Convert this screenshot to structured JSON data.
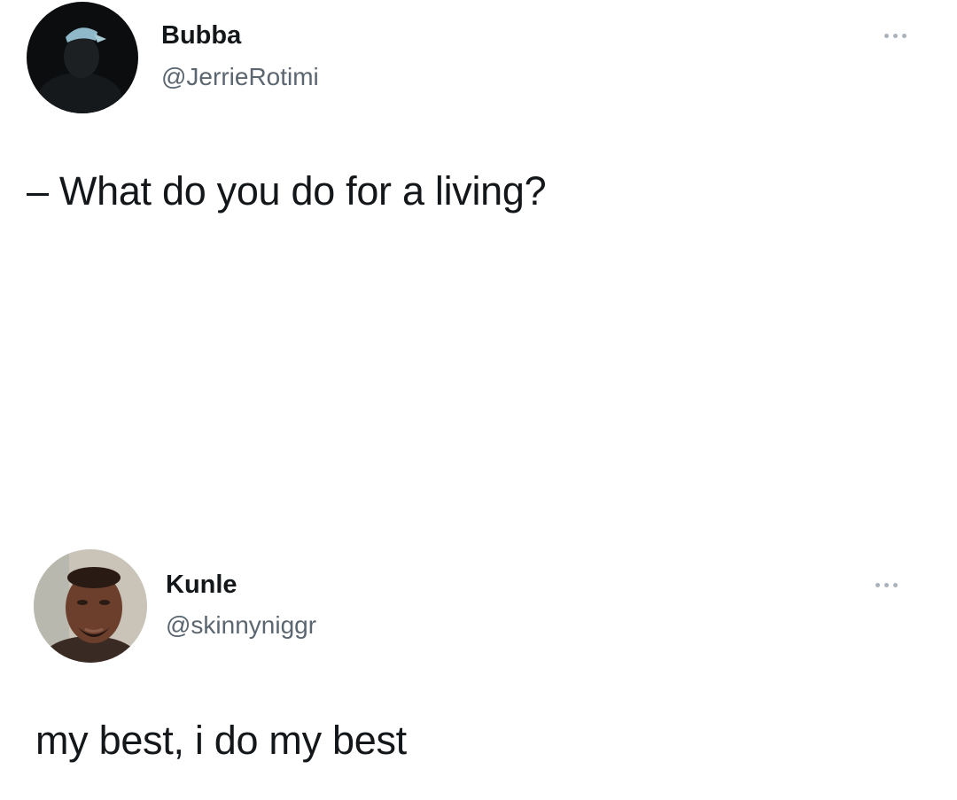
{
  "tweets": [
    {
      "display_name": "Bubba",
      "handle": "@JerrieRotimi",
      "text": "– What do you do for a living?",
      "avatar_icon": "avatar-dark-cap-icon",
      "more_icon": "more-options-icon"
    },
    {
      "display_name": "Kunle",
      "handle": "@skinnyniggr",
      "text": "my best, i do my best",
      "avatar_icon": "avatar-face-icon",
      "more_icon": "more-options-icon"
    }
  ],
  "colors": {
    "background": "#ffffff",
    "text": "#14171a",
    "handle": "#5b6670",
    "more_dots": "#aab3bb"
  }
}
